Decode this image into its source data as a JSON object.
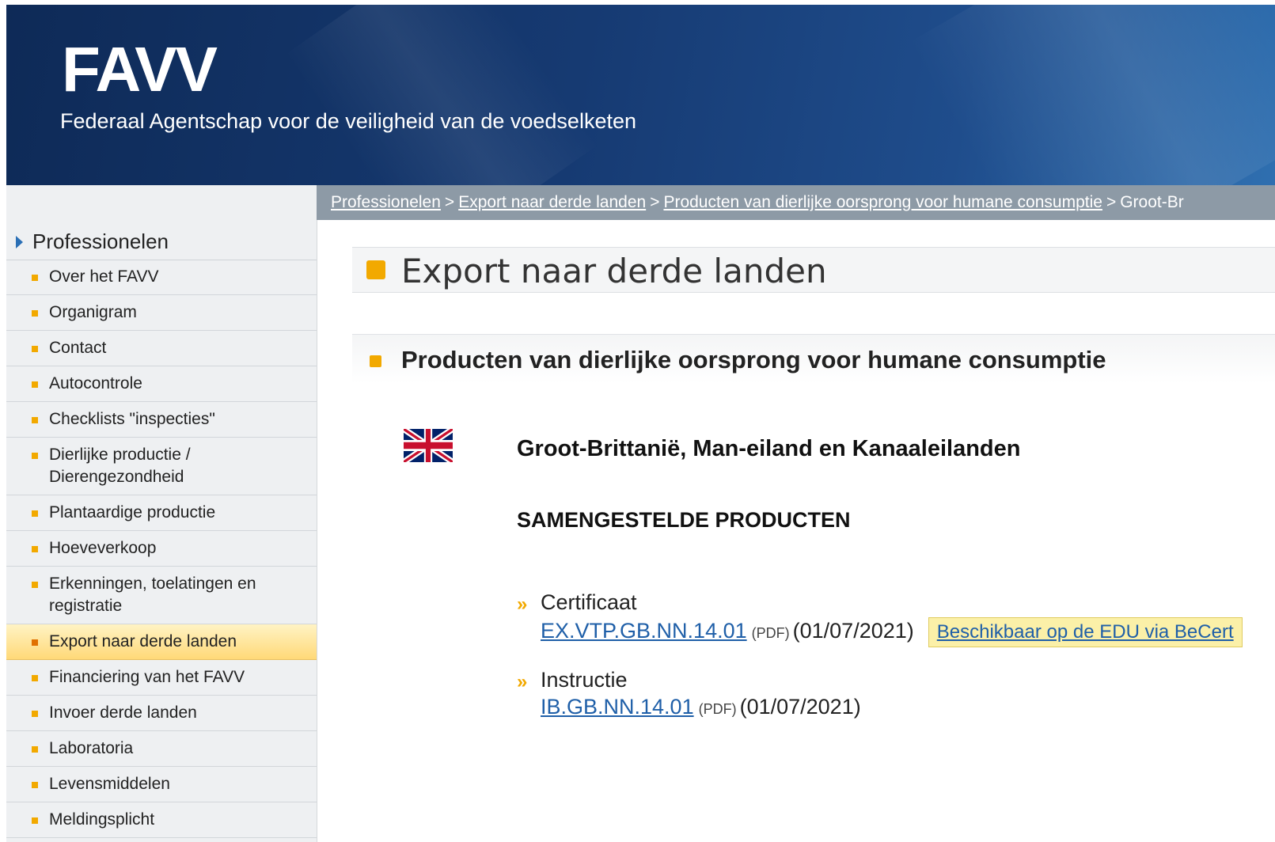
{
  "header": {
    "logo": "FAVV",
    "subtitle": "Federaal Agentschap voor de veiligheid van de voedselketen"
  },
  "breadcrumb": {
    "items": [
      "Professionelen",
      "Export naar derde landen",
      "Producten van dierlijke oorsprong voor humane consumptie"
    ],
    "current": "Groot-Br",
    "separator": ">"
  },
  "sidebar": {
    "heading": "Professionelen",
    "items": [
      {
        "label": "Over het FAVV"
      },
      {
        "label": "Organigram"
      },
      {
        "label": "Contact"
      },
      {
        "label": "Autocontrole"
      },
      {
        "label": "Checklists \"inspecties\""
      },
      {
        "label": "Dierlijke productie / Dierengezondheid"
      },
      {
        "label": "Plantaardige productie"
      },
      {
        "label": "Hoeveverkoop"
      },
      {
        "label": "Erkenningen, toelatingen en registratie"
      },
      {
        "label": "Export naar derde landen",
        "active": true
      },
      {
        "label": "Financiering van het FAVV"
      },
      {
        "label": "Invoer derde landen"
      },
      {
        "label": "Laboratoria"
      },
      {
        "label": "Levensmiddelen"
      },
      {
        "label": "Meldingsplicht"
      }
    ]
  },
  "main": {
    "title": "Export naar derde landen",
    "subtitle": "Producten van dierlijke oorsprong voor humane consumptie",
    "country": "Groot-Brittanië, Man-eiland en Kanaaleilanden",
    "section": "SAMENGESTELDE PRODUCTEN",
    "documents": [
      {
        "type": "Certificaat",
        "code": "EX.VTP.GB.NN.14.01",
        "format": "(PDF)",
        "date": "(01/07/2021)",
        "note": "Beschikbaar op de EDU via BeCert"
      },
      {
        "type": "Instructie",
        "code": "IB.GB.NN.14.01",
        "format": "(PDF)",
        "date": "(01/07/2021)"
      }
    ]
  },
  "colors": {
    "header_dark": "#0e2a57",
    "accent_orange": "#f2a900",
    "link_blue": "#1f5fa8",
    "breadcrumb_bg": "#8d9aa6"
  },
  "icons": [
    "triangle-right-icon",
    "square-bullet-icon",
    "uk-flag-icon",
    "double-chevron-icon"
  ]
}
